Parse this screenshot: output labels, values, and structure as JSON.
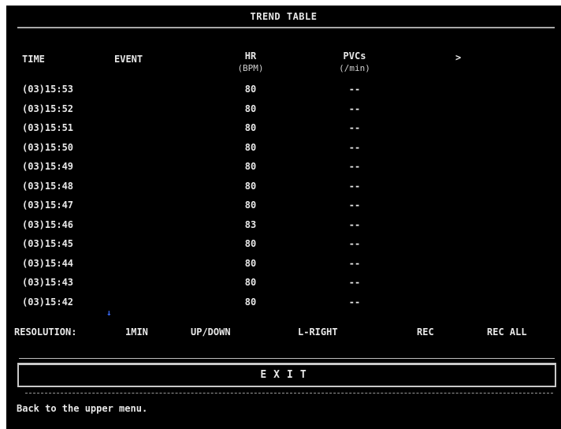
{
  "title": "TREND TABLE",
  "columns": {
    "time": "TIME",
    "event": "EVENT",
    "hr": "HR",
    "hr_unit": "(BPM)",
    "pvcs": "PVCs",
    "pvcs_unit": "(/min)",
    "next_page": ">"
  },
  "rows": [
    {
      "time": "(03)15:53",
      "hr": "80",
      "pvcs": "--"
    },
    {
      "time": "(03)15:52",
      "hr": "80",
      "pvcs": "--"
    },
    {
      "time": "(03)15:51",
      "hr": "80",
      "pvcs": "--"
    },
    {
      "time": "(03)15:50",
      "hr": "80",
      "pvcs": "--"
    },
    {
      "time": "(03)15:49",
      "hr": "80",
      "pvcs": "--"
    },
    {
      "time": "(03)15:48",
      "hr": "80",
      "pvcs": "--"
    },
    {
      "time": "(03)15:47",
      "hr": "80",
      "pvcs": "--"
    },
    {
      "time": "(03)15:46",
      "hr": "83",
      "pvcs": "--"
    },
    {
      "time": "(03)15:45",
      "hr": "80",
      "pvcs": "--"
    },
    {
      "time": "(03)15:44",
      "hr": "80",
      "pvcs": "--"
    },
    {
      "time": "(03)15:43",
      "hr": "80",
      "pvcs": "--"
    },
    {
      "time": "(03)15:42",
      "hr": "80",
      "pvcs": "--"
    }
  ],
  "scroll_indicator": "↓",
  "menu": {
    "resolution_label": "RESOLUTION:",
    "resolution_value": "1MIN",
    "up_down": "UP/DOWN",
    "l_right": "L-RIGHT",
    "rec": "REC",
    "rec_all": "REC ALL"
  },
  "exit_label": "EXIT",
  "status_text": "Back to the upper menu.",
  "colors": {
    "background": "#000000",
    "text": "#e8e8e8",
    "scroll_indicator": "#3a6cff"
  },
  "icons": {
    "scroll_indicator": "arrow-down-icon",
    "next_page": "chevron-right-icon"
  }
}
